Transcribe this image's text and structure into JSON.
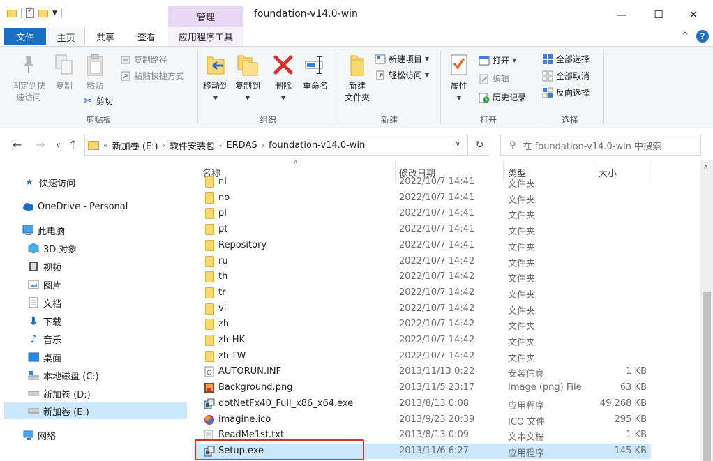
{
  "window": {
    "title": "foundation-v14.0-win",
    "manage_tab": "管理",
    "minimize": "—",
    "maximize": "☐",
    "close": "✕"
  },
  "tabs": {
    "file": "文件",
    "home": "主页",
    "share": "共享",
    "view": "查看",
    "app_tools": "应用程序工具",
    "collapse": "^",
    "help": "?"
  },
  "ribbon": {
    "clipboard": {
      "label": "剪贴板",
      "pin_line1": "固定到快",
      "pin_line2": "速访问",
      "copy": "复制",
      "paste": "粘贴",
      "copy_path": "复制路径",
      "paste_shortcut": "粘贴快捷方式",
      "cut": "剪切"
    },
    "organize": {
      "label": "组织",
      "move_to": "移动到",
      "copy_to": "复制到",
      "delete": "删除",
      "rename": "重命名"
    },
    "new": {
      "label": "新建",
      "new_folder_line1": "新建",
      "new_folder_line2": "文件夹",
      "new_item": "新建项目",
      "easy_access": "轻松访问"
    },
    "open": {
      "label": "打开",
      "properties": "属性",
      "open": "打开",
      "edit": "编辑",
      "history": "历史记录"
    },
    "select": {
      "label": "选择",
      "select_all": "全部选择",
      "select_none": "全部取消",
      "invert": "反向选择"
    }
  },
  "address": {
    "overflow": "«",
    "crumbs": [
      "新加卷 (E:)",
      "软件安装包",
      "ERDAS",
      "foundation-v14.0-win"
    ],
    "search_placeholder": "在 foundation-v14.0-win 中搜索"
  },
  "nav": {
    "quick_access": "快速访问",
    "onedrive": "OneDrive - Personal",
    "this_pc": "此电脑",
    "objects3d": "3D 对象",
    "videos": "视频",
    "pictures": "图片",
    "documents": "文档",
    "downloads": "下载",
    "music": "音乐",
    "desktop": "桌面",
    "local_c": "本地磁盘 (C:)",
    "vol_d": "新加卷 (D:)",
    "vol_e": "新加卷 (E:)",
    "network": "网络"
  },
  "columns": {
    "name": "名称",
    "date": "修改日期",
    "type": "类型",
    "size": "大小"
  },
  "files": [
    {
      "name": "nl",
      "date": "2022/10/7 14:41",
      "type": "文件夹",
      "size": "",
      "icon": "folder"
    },
    {
      "name": "no",
      "date": "2022/10/7 14:41",
      "type": "文件夹",
      "size": "",
      "icon": "folder"
    },
    {
      "name": "pl",
      "date": "2022/10/7 14:41",
      "type": "文件夹",
      "size": "",
      "icon": "folder"
    },
    {
      "name": "pt",
      "date": "2022/10/7 14:41",
      "type": "文件夹",
      "size": "",
      "icon": "folder"
    },
    {
      "name": "Repository",
      "date": "2022/10/7 14:41",
      "type": "文件夹",
      "size": "",
      "icon": "folder"
    },
    {
      "name": "ru",
      "date": "2022/10/7 14:42",
      "type": "文件夹",
      "size": "",
      "icon": "folder"
    },
    {
      "name": "th",
      "date": "2022/10/7 14:42",
      "type": "文件夹",
      "size": "",
      "icon": "folder"
    },
    {
      "name": "tr",
      "date": "2022/10/7 14:42",
      "type": "文件夹",
      "size": "",
      "icon": "folder"
    },
    {
      "name": "vi",
      "date": "2022/10/7 14:42",
      "type": "文件夹",
      "size": "",
      "icon": "folder"
    },
    {
      "name": "zh",
      "date": "2022/10/7 14:42",
      "type": "文件夹",
      "size": "",
      "icon": "folder"
    },
    {
      "name": "zh-HK",
      "date": "2022/10/7 14:42",
      "type": "文件夹",
      "size": "",
      "icon": "folder"
    },
    {
      "name": "zh-TW",
      "date": "2022/10/7 14:42",
      "type": "文件夹",
      "size": "",
      "icon": "folder"
    },
    {
      "name": "AUTORUN.INF",
      "date": "2013/11/13 0:22",
      "type": "安装信息",
      "size": "1 KB",
      "icon": "inf"
    },
    {
      "name": "Background.png",
      "date": "2013/11/5 23:17",
      "type": "Image (png) File",
      "size": "63 KB",
      "icon": "image"
    },
    {
      "name": "dotNetFx40_Full_x86_x64.exe",
      "date": "2013/8/13 0:08",
      "type": "应用程序",
      "size": "49,268 KB",
      "icon": "setup-exe"
    },
    {
      "name": "imagine.ico",
      "date": "2013/9/23 20:39",
      "type": "ICO 文件",
      "size": "295 KB",
      "icon": "ico"
    },
    {
      "name": "ReadMe1st.txt",
      "date": "2013/8/13 0:09",
      "type": "文本文档",
      "size": "1 KB",
      "icon": "txt"
    },
    {
      "name": "Setup.exe",
      "date": "2013/11/6 6:27",
      "type": "应用程序",
      "size": "145 KB",
      "icon": "setup-exe",
      "selected": true
    }
  ],
  "colors": {
    "accent": "#1a6fc4",
    "selection": "#cce8ff",
    "highlight": "#d9302c",
    "folder": "#f8d775"
  }
}
